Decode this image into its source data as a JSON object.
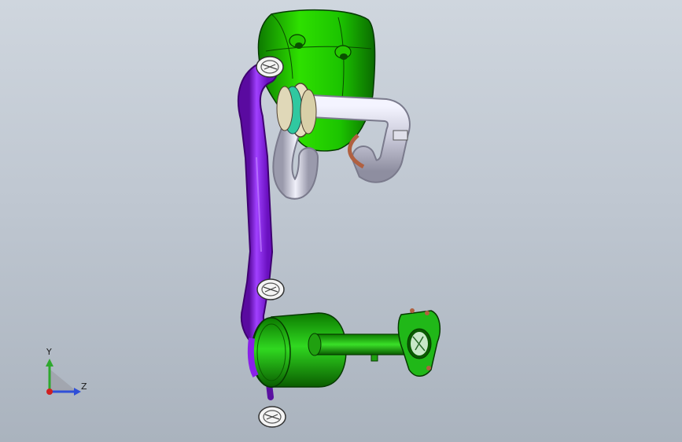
{
  "triad": {
    "y_label": "Y",
    "z_label": "Z",
    "y_color": "#2ea82e",
    "z_color": "#2f4fd8",
    "x_color": "#d02020"
  },
  "colors": {
    "background_top": "#cfd6de",
    "background_bottom": "#aab3be",
    "tank_green": "#1fd400",
    "pipe_purple": "#8a20e8",
    "pipe_silver": "#d8d8e8",
    "muffler_green": "#20c010",
    "copper": "#b06040"
  },
  "model": {
    "parts": [
      {
        "name": "green-tank"
      },
      {
        "name": "purple-exhaust-pipe"
      },
      {
        "name": "silver-header-pipe"
      },
      {
        "name": "muffler"
      },
      {
        "name": "outlet-flange"
      },
      {
        "name": "hanger-brackets"
      }
    ]
  }
}
